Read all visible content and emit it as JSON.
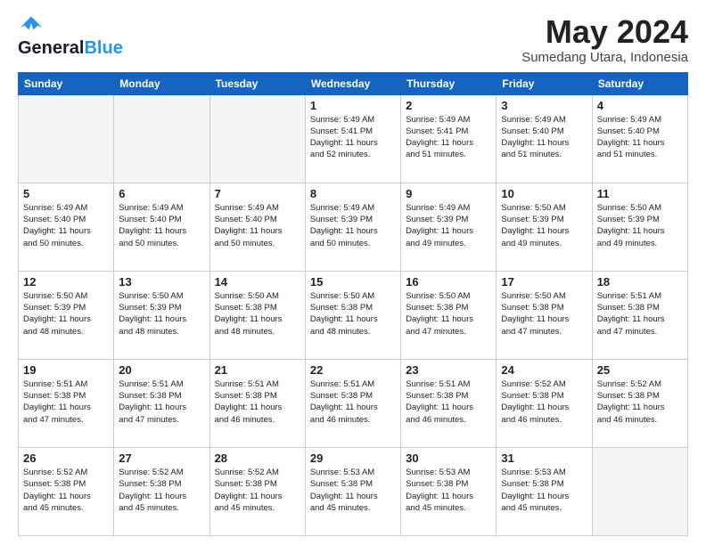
{
  "header": {
    "logo_general": "General",
    "logo_blue": "Blue",
    "month_title": "May 2024",
    "location": "Sumedang Utara, Indonesia"
  },
  "weekdays": [
    "Sunday",
    "Monday",
    "Tuesday",
    "Wednesday",
    "Thursday",
    "Friday",
    "Saturday"
  ],
  "weeks": [
    [
      {
        "day": "",
        "text": ""
      },
      {
        "day": "",
        "text": ""
      },
      {
        "day": "",
        "text": ""
      },
      {
        "day": "1",
        "text": "Sunrise: 5:49 AM\nSunset: 5:41 PM\nDaylight: 11 hours\nand 52 minutes."
      },
      {
        "day": "2",
        "text": "Sunrise: 5:49 AM\nSunset: 5:41 PM\nDaylight: 11 hours\nand 51 minutes."
      },
      {
        "day": "3",
        "text": "Sunrise: 5:49 AM\nSunset: 5:40 PM\nDaylight: 11 hours\nand 51 minutes."
      },
      {
        "day": "4",
        "text": "Sunrise: 5:49 AM\nSunset: 5:40 PM\nDaylight: 11 hours\nand 51 minutes."
      }
    ],
    [
      {
        "day": "5",
        "text": "Sunrise: 5:49 AM\nSunset: 5:40 PM\nDaylight: 11 hours\nand 50 minutes."
      },
      {
        "day": "6",
        "text": "Sunrise: 5:49 AM\nSunset: 5:40 PM\nDaylight: 11 hours\nand 50 minutes."
      },
      {
        "day": "7",
        "text": "Sunrise: 5:49 AM\nSunset: 5:40 PM\nDaylight: 11 hours\nand 50 minutes."
      },
      {
        "day": "8",
        "text": "Sunrise: 5:49 AM\nSunset: 5:39 PM\nDaylight: 11 hours\nand 50 minutes."
      },
      {
        "day": "9",
        "text": "Sunrise: 5:49 AM\nSunset: 5:39 PM\nDaylight: 11 hours\nand 49 minutes."
      },
      {
        "day": "10",
        "text": "Sunrise: 5:50 AM\nSunset: 5:39 PM\nDaylight: 11 hours\nand 49 minutes."
      },
      {
        "day": "11",
        "text": "Sunrise: 5:50 AM\nSunset: 5:39 PM\nDaylight: 11 hours\nand 49 minutes."
      }
    ],
    [
      {
        "day": "12",
        "text": "Sunrise: 5:50 AM\nSunset: 5:39 PM\nDaylight: 11 hours\nand 48 minutes."
      },
      {
        "day": "13",
        "text": "Sunrise: 5:50 AM\nSunset: 5:39 PM\nDaylight: 11 hours\nand 48 minutes."
      },
      {
        "day": "14",
        "text": "Sunrise: 5:50 AM\nSunset: 5:38 PM\nDaylight: 11 hours\nand 48 minutes."
      },
      {
        "day": "15",
        "text": "Sunrise: 5:50 AM\nSunset: 5:38 PM\nDaylight: 11 hours\nand 48 minutes."
      },
      {
        "day": "16",
        "text": "Sunrise: 5:50 AM\nSunset: 5:38 PM\nDaylight: 11 hours\nand 47 minutes."
      },
      {
        "day": "17",
        "text": "Sunrise: 5:50 AM\nSunset: 5:38 PM\nDaylight: 11 hours\nand 47 minutes."
      },
      {
        "day": "18",
        "text": "Sunrise: 5:51 AM\nSunset: 5:38 PM\nDaylight: 11 hours\nand 47 minutes."
      }
    ],
    [
      {
        "day": "19",
        "text": "Sunrise: 5:51 AM\nSunset: 5:38 PM\nDaylight: 11 hours\nand 47 minutes."
      },
      {
        "day": "20",
        "text": "Sunrise: 5:51 AM\nSunset: 5:38 PM\nDaylight: 11 hours\nand 47 minutes."
      },
      {
        "day": "21",
        "text": "Sunrise: 5:51 AM\nSunset: 5:38 PM\nDaylight: 11 hours\nand 46 minutes."
      },
      {
        "day": "22",
        "text": "Sunrise: 5:51 AM\nSunset: 5:38 PM\nDaylight: 11 hours\nand 46 minutes."
      },
      {
        "day": "23",
        "text": "Sunrise: 5:51 AM\nSunset: 5:38 PM\nDaylight: 11 hours\nand 46 minutes."
      },
      {
        "day": "24",
        "text": "Sunrise: 5:52 AM\nSunset: 5:38 PM\nDaylight: 11 hours\nand 46 minutes."
      },
      {
        "day": "25",
        "text": "Sunrise: 5:52 AM\nSunset: 5:38 PM\nDaylight: 11 hours\nand 46 minutes."
      }
    ],
    [
      {
        "day": "26",
        "text": "Sunrise: 5:52 AM\nSunset: 5:38 PM\nDaylight: 11 hours\nand 45 minutes."
      },
      {
        "day": "27",
        "text": "Sunrise: 5:52 AM\nSunset: 5:38 PM\nDaylight: 11 hours\nand 45 minutes."
      },
      {
        "day": "28",
        "text": "Sunrise: 5:52 AM\nSunset: 5:38 PM\nDaylight: 11 hours\nand 45 minutes."
      },
      {
        "day": "29",
        "text": "Sunrise: 5:53 AM\nSunset: 5:38 PM\nDaylight: 11 hours\nand 45 minutes."
      },
      {
        "day": "30",
        "text": "Sunrise: 5:53 AM\nSunset: 5:38 PM\nDaylight: 11 hours\nand 45 minutes."
      },
      {
        "day": "31",
        "text": "Sunrise: 5:53 AM\nSunset: 5:38 PM\nDaylight: 11 hours\nand 45 minutes."
      },
      {
        "day": "",
        "text": ""
      }
    ]
  ]
}
